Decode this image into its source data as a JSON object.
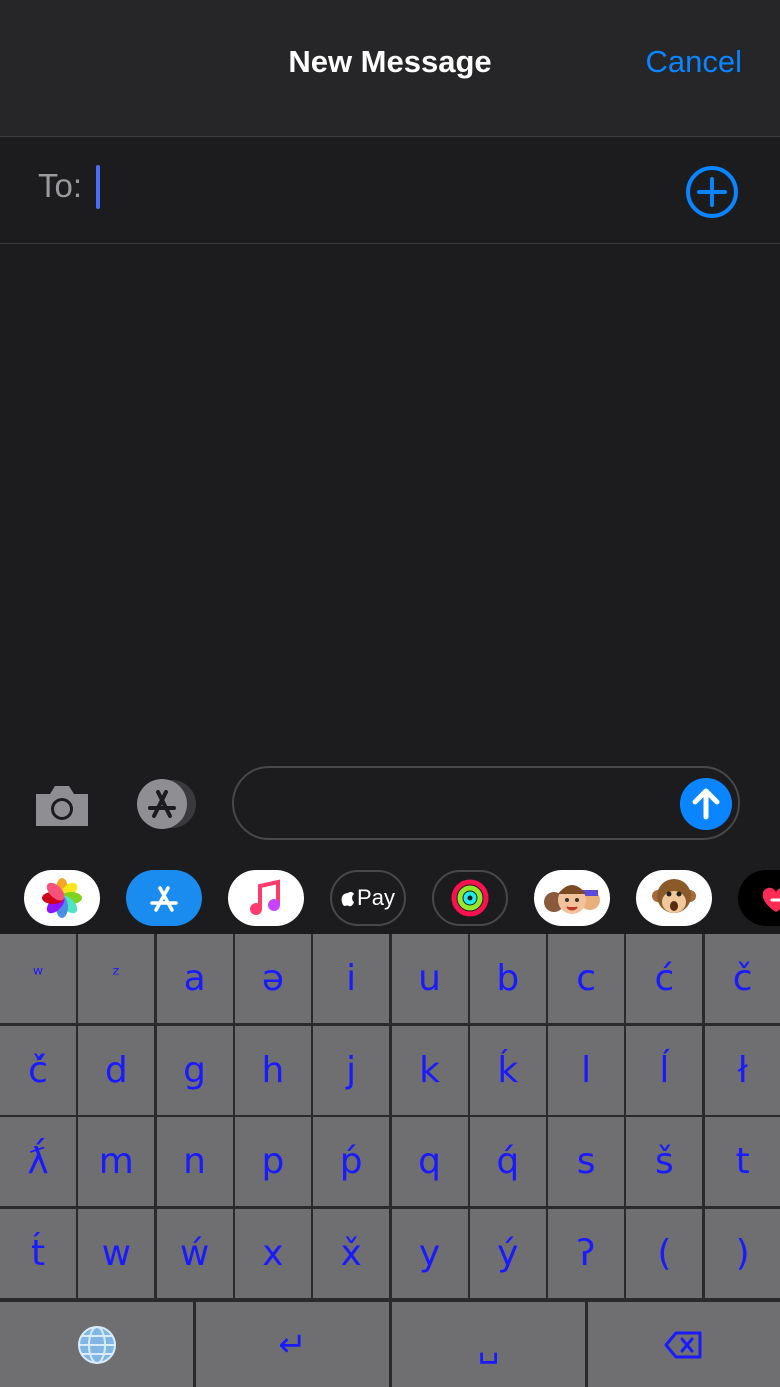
{
  "header": {
    "title": "New Message",
    "cancel_label": "Cancel"
  },
  "recipient": {
    "label": "To:",
    "value": ""
  },
  "watermark": "",
  "compose": {
    "placeholder": ""
  },
  "apps": [
    {
      "name": "photos-app-icon"
    },
    {
      "name": "app-store-icon"
    },
    {
      "name": "music-app-icon"
    },
    {
      "name": "apple-pay-icon",
      "label": "Pay"
    },
    {
      "name": "activity-app-icon"
    },
    {
      "name": "memoji-stickers-icon"
    },
    {
      "name": "animoji-monkey-icon"
    },
    {
      "name": "digital-touch-icon"
    }
  ],
  "keyboard": {
    "rows": [
      [
        "ʷ",
        "ᶻ",
        "a",
        "ə",
        "i",
        "u",
        "b",
        "c",
        "ć",
        "č"
      ],
      [
        "č́",
        "d",
        "g",
        "h",
        "j",
        "k",
        "ḱ",
        "l",
        "ĺ",
        "ł"
      ],
      [
        "ƛ́",
        "m",
        "n",
        "p",
        "ṕ",
        "q",
        "q́",
        "s",
        "š",
        "t"
      ],
      [
        "t́",
        "w",
        "ẃ",
        "x",
        "x̌",
        "y",
        "ý",
        "ʔ",
        "(",
        ")"
      ]
    ],
    "bottom": {
      "return_label": "↵",
      "space_label": "␣"
    }
  },
  "colors": {
    "accent": "#0a84ff",
    "key_text": "#1a1aff",
    "key_bg": "#6f6f72",
    "background": "#1c1c1e"
  }
}
